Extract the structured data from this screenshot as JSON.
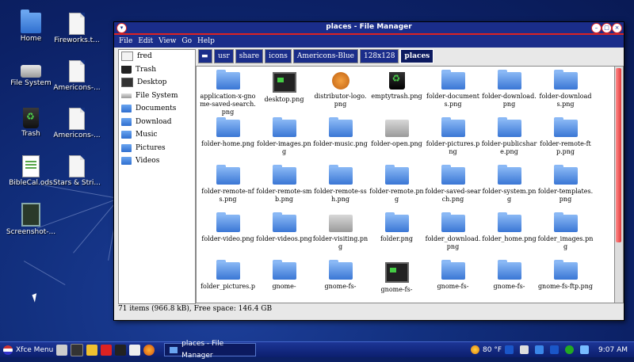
{
  "desktop": {
    "icons": [
      {
        "label": "Home",
        "type": "folder"
      },
      {
        "label": "Fireworks.t...",
        "type": "doc"
      },
      {
        "label": "File System",
        "type": "drive"
      },
      {
        "label": "Americons-...",
        "type": "doc"
      },
      {
        "label": "Trash",
        "type": "trash"
      },
      {
        "label": "Americons-...",
        "type": "doc"
      },
      {
        "label": "BibleCal.ods",
        "type": "sheet"
      },
      {
        "label": "Stars & Stri...",
        "type": "doc"
      },
      {
        "label": "Screenshot-...",
        "type": "image"
      }
    ]
  },
  "window": {
    "title": "places - File Manager",
    "menu": [
      "File",
      "Edit",
      "View",
      "Go",
      "Help"
    ],
    "menu_accel": [
      "F",
      "E",
      "V",
      "G",
      "H"
    ],
    "sidebar": [
      {
        "label": "fred",
        "icon": "home-icon"
      },
      {
        "label": "Trash",
        "icon": "trash-icon"
      },
      {
        "label": "Desktop",
        "icon": "desktop-icon"
      },
      {
        "label": "File System",
        "icon": "drive-icon"
      },
      {
        "label": "Documents",
        "icon": "folder-icon"
      },
      {
        "label": "Download",
        "icon": "folder-icon"
      },
      {
        "label": "Music",
        "icon": "folder-icon"
      },
      {
        "label": "Pictures",
        "icon": "folder-icon"
      },
      {
        "label": "Videos",
        "icon": "folder-icon"
      }
    ],
    "path": [
      "usr",
      "share",
      "icons",
      "Americons-Blue",
      "128x128",
      "places"
    ],
    "files": [
      {
        "name": "application-x-gnome-saved-search.png",
        "kind": "search"
      },
      {
        "name": "desktop.png",
        "kind": "term"
      },
      {
        "name": "distributor-logo.png",
        "kind": "pcos"
      },
      {
        "name": "emptytrash.png",
        "kind": "trash"
      },
      {
        "name": "folder-documents.png",
        "kind": "folder"
      },
      {
        "name": "folder-download.png",
        "kind": "folder"
      },
      {
        "name": "folder-downloads.png",
        "kind": "folder"
      },
      {
        "name": "folder-home.png",
        "kind": "folder"
      },
      {
        "name": "folder-images.png",
        "kind": "folder"
      },
      {
        "name": "folder-music.png",
        "kind": "folder"
      },
      {
        "name": "folder-open.png",
        "kind": "grey"
      },
      {
        "name": "folder-pictures.png",
        "kind": "folder"
      },
      {
        "name": "folder-publicshare.png",
        "kind": "folder"
      },
      {
        "name": "folder-remote-ftp.png",
        "kind": "folder"
      },
      {
        "name": "folder-remote-nfs.png",
        "kind": "folder"
      },
      {
        "name": "folder-remote-smb.png",
        "kind": "folder"
      },
      {
        "name": "folder-remote-ssh.png",
        "kind": "folder"
      },
      {
        "name": "folder-remote.png",
        "kind": "folder"
      },
      {
        "name": "folder-saved-search.png",
        "kind": "folder"
      },
      {
        "name": "folder-system.png",
        "kind": "folder"
      },
      {
        "name": "folder-templates.png",
        "kind": "folder"
      },
      {
        "name": "folder-video.png",
        "kind": "folder"
      },
      {
        "name": "folder-videos.png",
        "kind": "folder"
      },
      {
        "name": "folder-visiting.png",
        "kind": "grey"
      },
      {
        "name": "folder.png",
        "kind": "folder"
      },
      {
        "name": "folder_download.png",
        "kind": "folder"
      },
      {
        "name": "folder_home.png",
        "kind": "folder"
      },
      {
        "name": "folder_images.png",
        "kind": "folder"
      },
      {
        "name": "folder_pictures.p",
        "kind": "folder"
      },
      {
        "name": "gnome-",
        "kind": "folder"
      },
      {
        "name": "gnome-fs-",
        "kind": "folder"
      },
      {
        "name": "gnome-fs-",
        "kind": "term"
      },
      {
        "name": "gnome-fs-",
        "kind": "folder"
      },
      {
        "name": "gnome-fs-",
        "kind": "folder"
      },
      {
        "name": "gnome-fs-ftp.png",
        "kind": "folder"
      }
    ],
    "status": "71 items (966.8 kB), Free space: 146.4 GB"
  },
  "taskbar": {
    "menu_label": "Xfce Menu",
    "task_label": "places - File Manager",
    "temperature": "80 °F",
    "clock": "9:07 AM"
  }
}
